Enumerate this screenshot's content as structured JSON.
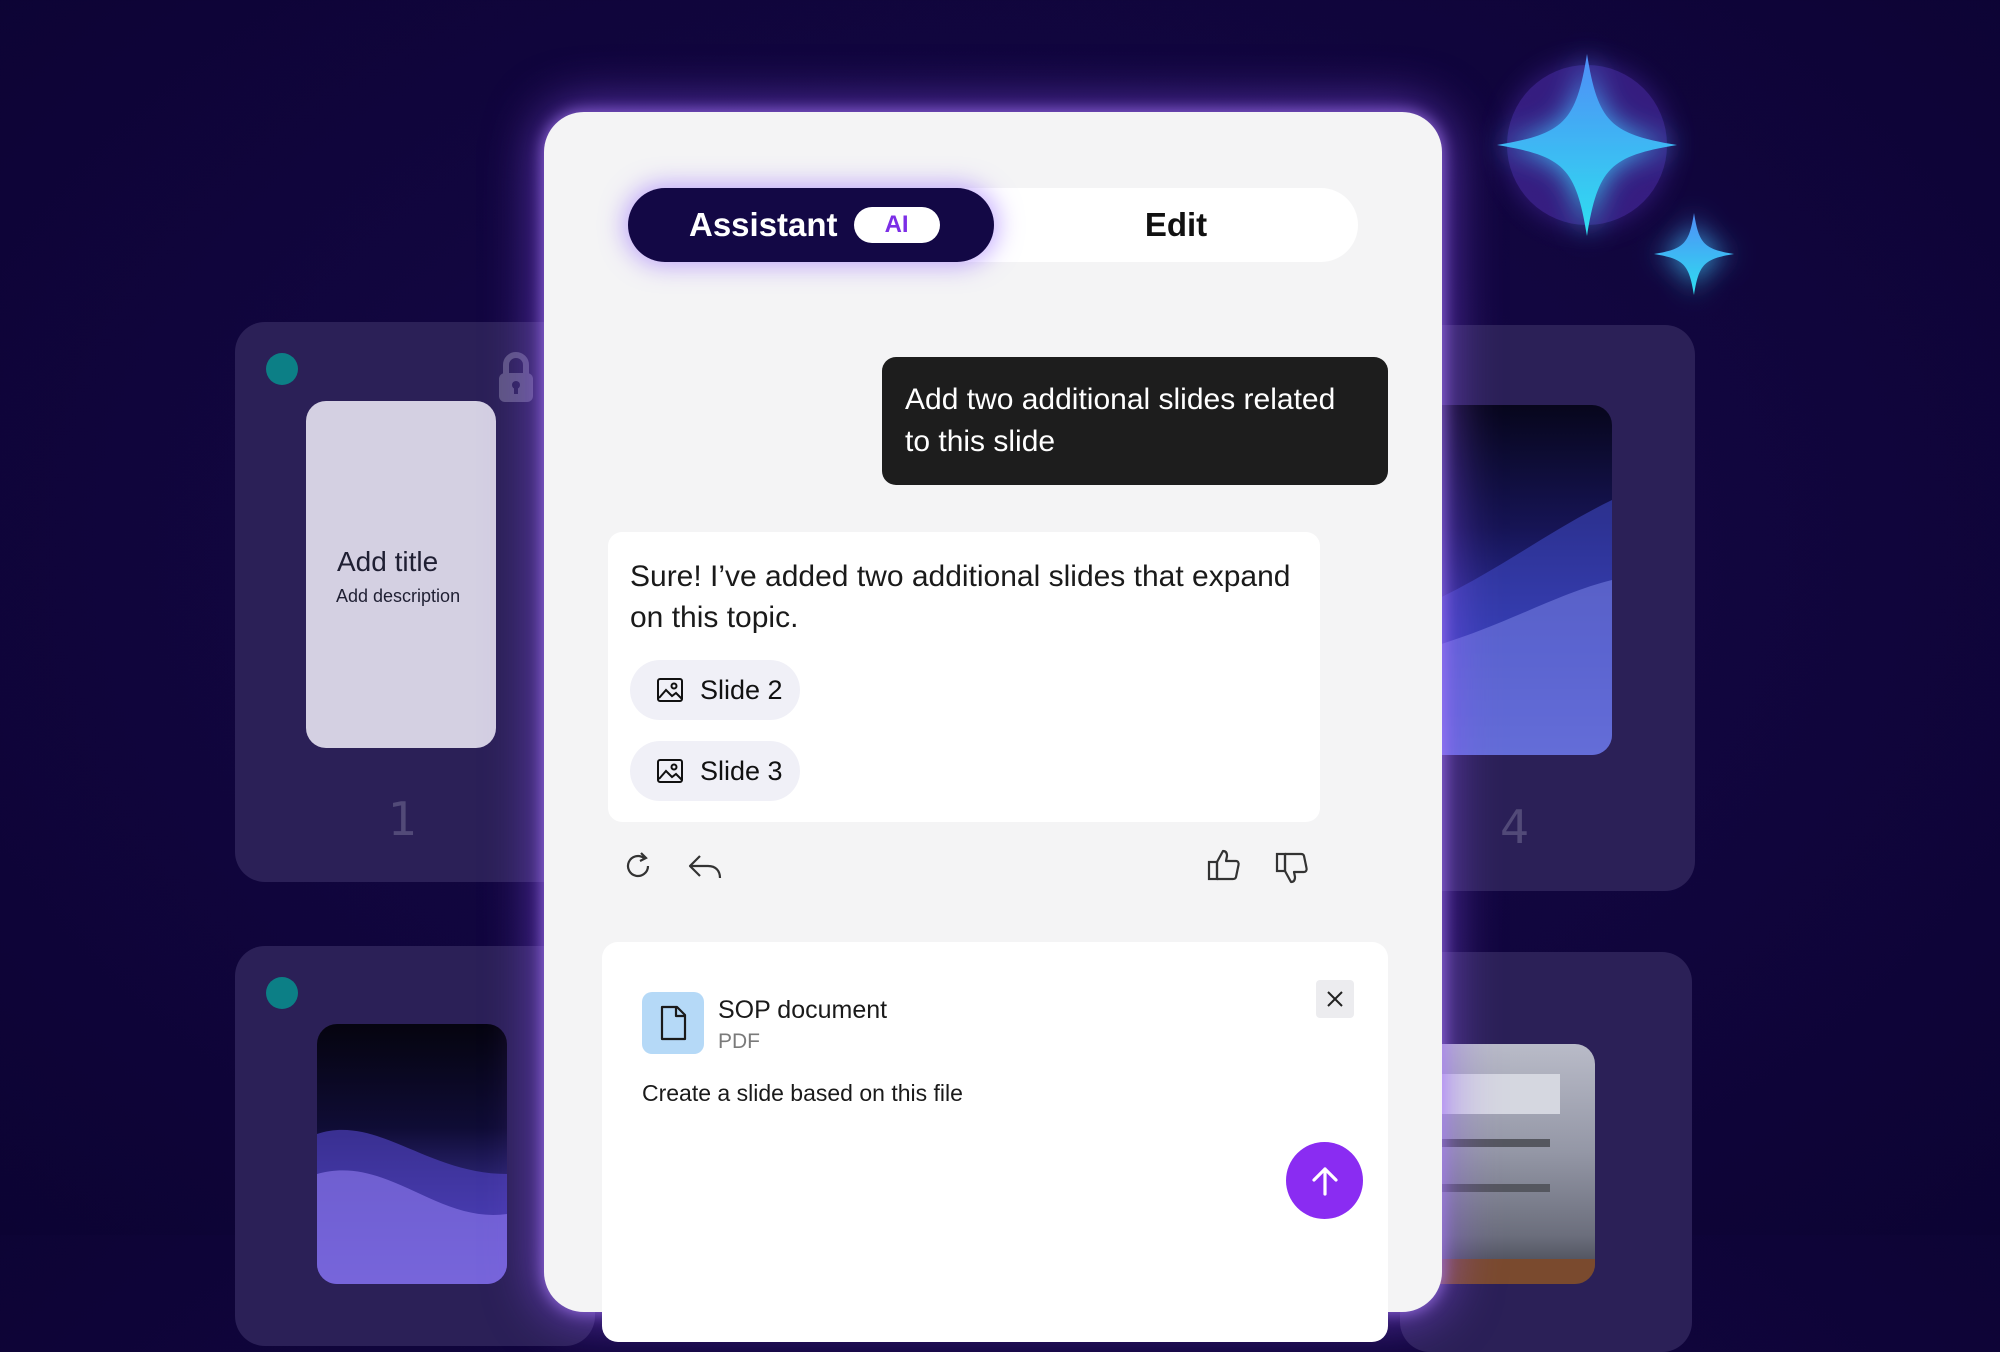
{
  "tabs": {
    "assistant_label": "Assistant",
    "ai_badge": "AI",
    "edit_label": "Edit"
  },
  "chat": {
    "user_message": "Add two additional slides related to this slide",
    "assistant_reply": "Sure! I’ve added two additional slides that expand on this topic.",
    "slide_chips": [
      "Slide 2",
      "Slide 3"
    ]
  },
  "attachment": {
    "file_name": "SOP document",
    "file_type": "PDF",
    "prompt": "Create a slide based on this file"
  },
  "background_slides": {
    "slide1_title": "Add title",
    "slide1_description": "Add description",
    "slide1_number": "1",
    "slide4_number": "4"
  },
  "icons": {
    "regenerate": "refresh-icon",
    "reply": "reply-icon",
    "like": "thumbs-up-icon",
    "dislike": "thumbs-down-icon",
    "file": "document-icon",
    "close": "close-icon",
    "send": "arrow-up-icon",
    "sparkle": "sparkle-icon",
    "lock": "lock-icon",
    "image": "image-icon"
  },
  "colors": {
    "background": "#120640",
    "accent": "#8a2cf2",
    "active_tab": "#130845",
    "sparkle": "#3cc4f7"
  }
}
